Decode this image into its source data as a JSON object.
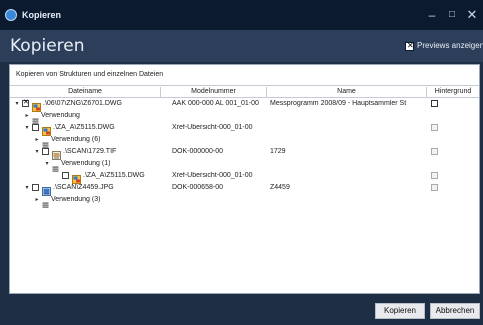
{
  "window": {
    "title": "Kopieren",
    "controls": {
      "minimize": "–",
      "maximize": "□",
      "close": "✕"
    }
  },
  "header": {
    "title": "Kopieren",
    "previews_label": "Previews anzeigen",
    "previews_checked": true
  },
  "subheading": "Kopieren von Strukturen und einzelnen Dateien",
  "table": {
    "columns": [
      "Dateiname",
      "Modelnummer",
      "Name",
      "Hintergrund"
    ],
    "rows": [
      {
        "level": 0,
        "expander": "▾",
        "checkbox": "checked",
        "icon": "dwg-file-icon",
        "filename": ".\\06\\07\\ZNG\\Z6701.DWG",
        "model": "AAK 000-000 AL 001_01-00",
        "name": "Messprogramm 2008/09 - Hauptsammler St",
        "hintergrund": "active"
      },
      {
        "level": 1,
        "expander": "▸",
        "checkbox": "none",
        "icon": "reference-icon",
        "filename": "Verwendung",
        "model": "",
        "name": "",
        "hintergrund": "none"
      },
      {
        "level": 1,
        "expander": "▾",
        "checkbox": "unchecked",
        "icon": "dwg-file-icon",
        "filename": ".\\ZA_A\\Z5115.DWG",
        "model": "Xref-Übersicht-000_01-00",
        "name": "",
        "hintergrund": "disabled"
      },
      {
        "level": 2,
        "expander": "▸",
        "checkbox": "none",
        "icon": "reference-icon",
        "filename": "Verwendung (6)",
        "model": "",
        "name": "",
        "hintergrund": "none"
      },
      {
        "level": 2,
        "expander": "▾",
        "checkbox": "unchecked",
        "icon": "tif-file-icon",
        "filename": ".\\SCAN\\1729.TIF",
        "model": "DOK-000000-00",
        "name": "1729",
        "hintergrund": "disabled"
      },
      {
        "level": 3,
        "expander": "▾",
        "checkbox": "none",
        "icon": "reference-icon",
        "filename": "Verwendung (1)",
        "model": "",
        "name": "",
        "hintergrund": "none"
      },
      {
        "level": 4,
        "expander": "",
        "checkbox": "unchecked",
        "icon": "dwg-file-icon",
        "filename": ".\\ZA_A\\Z5115.DWG",
        "model": "Xref-Übersicht-000_01-00",
        "name": "",
        "hintergrund": "disabled"
      },
      {
        "level": 1,
        "expander": "▾",
        "checkbox": "unchecked",
        "icon": "jpg-file-icon",
        "filename": ".\\SCAN\\Z4459.JPG",
        "model": "DOK-000658-00",
        "name": "Z4459",
        "hintergrund": "disabled"
      },
      {
        "level": 2,
        "expander": "▸",
        "checkbox": "none",
        "icon": "reference-icon",
        "filename": "Verwendung (3)",
        "model": "",
        "name": "",
        "hintergrund": "none"
      }
    ]
  },
  "buttons": {
    "ok": "Kopieren",
    "cancel": "Abbrechen"
  },
  "colors": {
    "titlebar": "#0b1a2f",
    "header": "#2c3e5a",
    "background": "#1e2e45",
    "accent": "#3b88d8"
  }
}
